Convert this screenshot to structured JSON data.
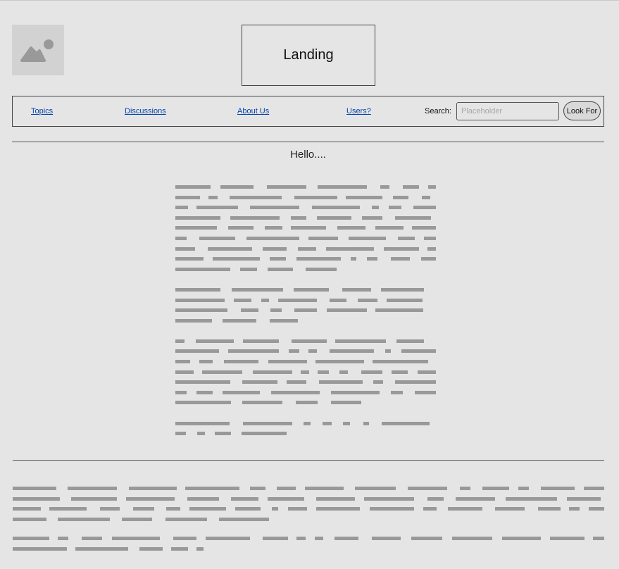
{
  "header": {
    "logo_icon": "image-placeholder-icon",
    "title": "Landing"
  },
  "nav": {
    "links": [
      "Topics",
      "Discussions",
      "About Us",
      "Users?"
    ],
    "search_label": "Search:",
    "search_placeholder": "Placeholder",
    "search_button": "Look For"
  },
  "main": {
    "heading": "Hello....",
    "paragraph_line_counts": [
      9,
      4,
      7,
      2
    ]
  },
  "footer": {
    "paragraph_line_counts": [
      4,
      2
    ]
  },
  "colors": {
    "background": "#e5e5e5",
    "border": "#444444",
    "link": "#0645ad",
    "placeholder_text": "#999999"
  }
}
